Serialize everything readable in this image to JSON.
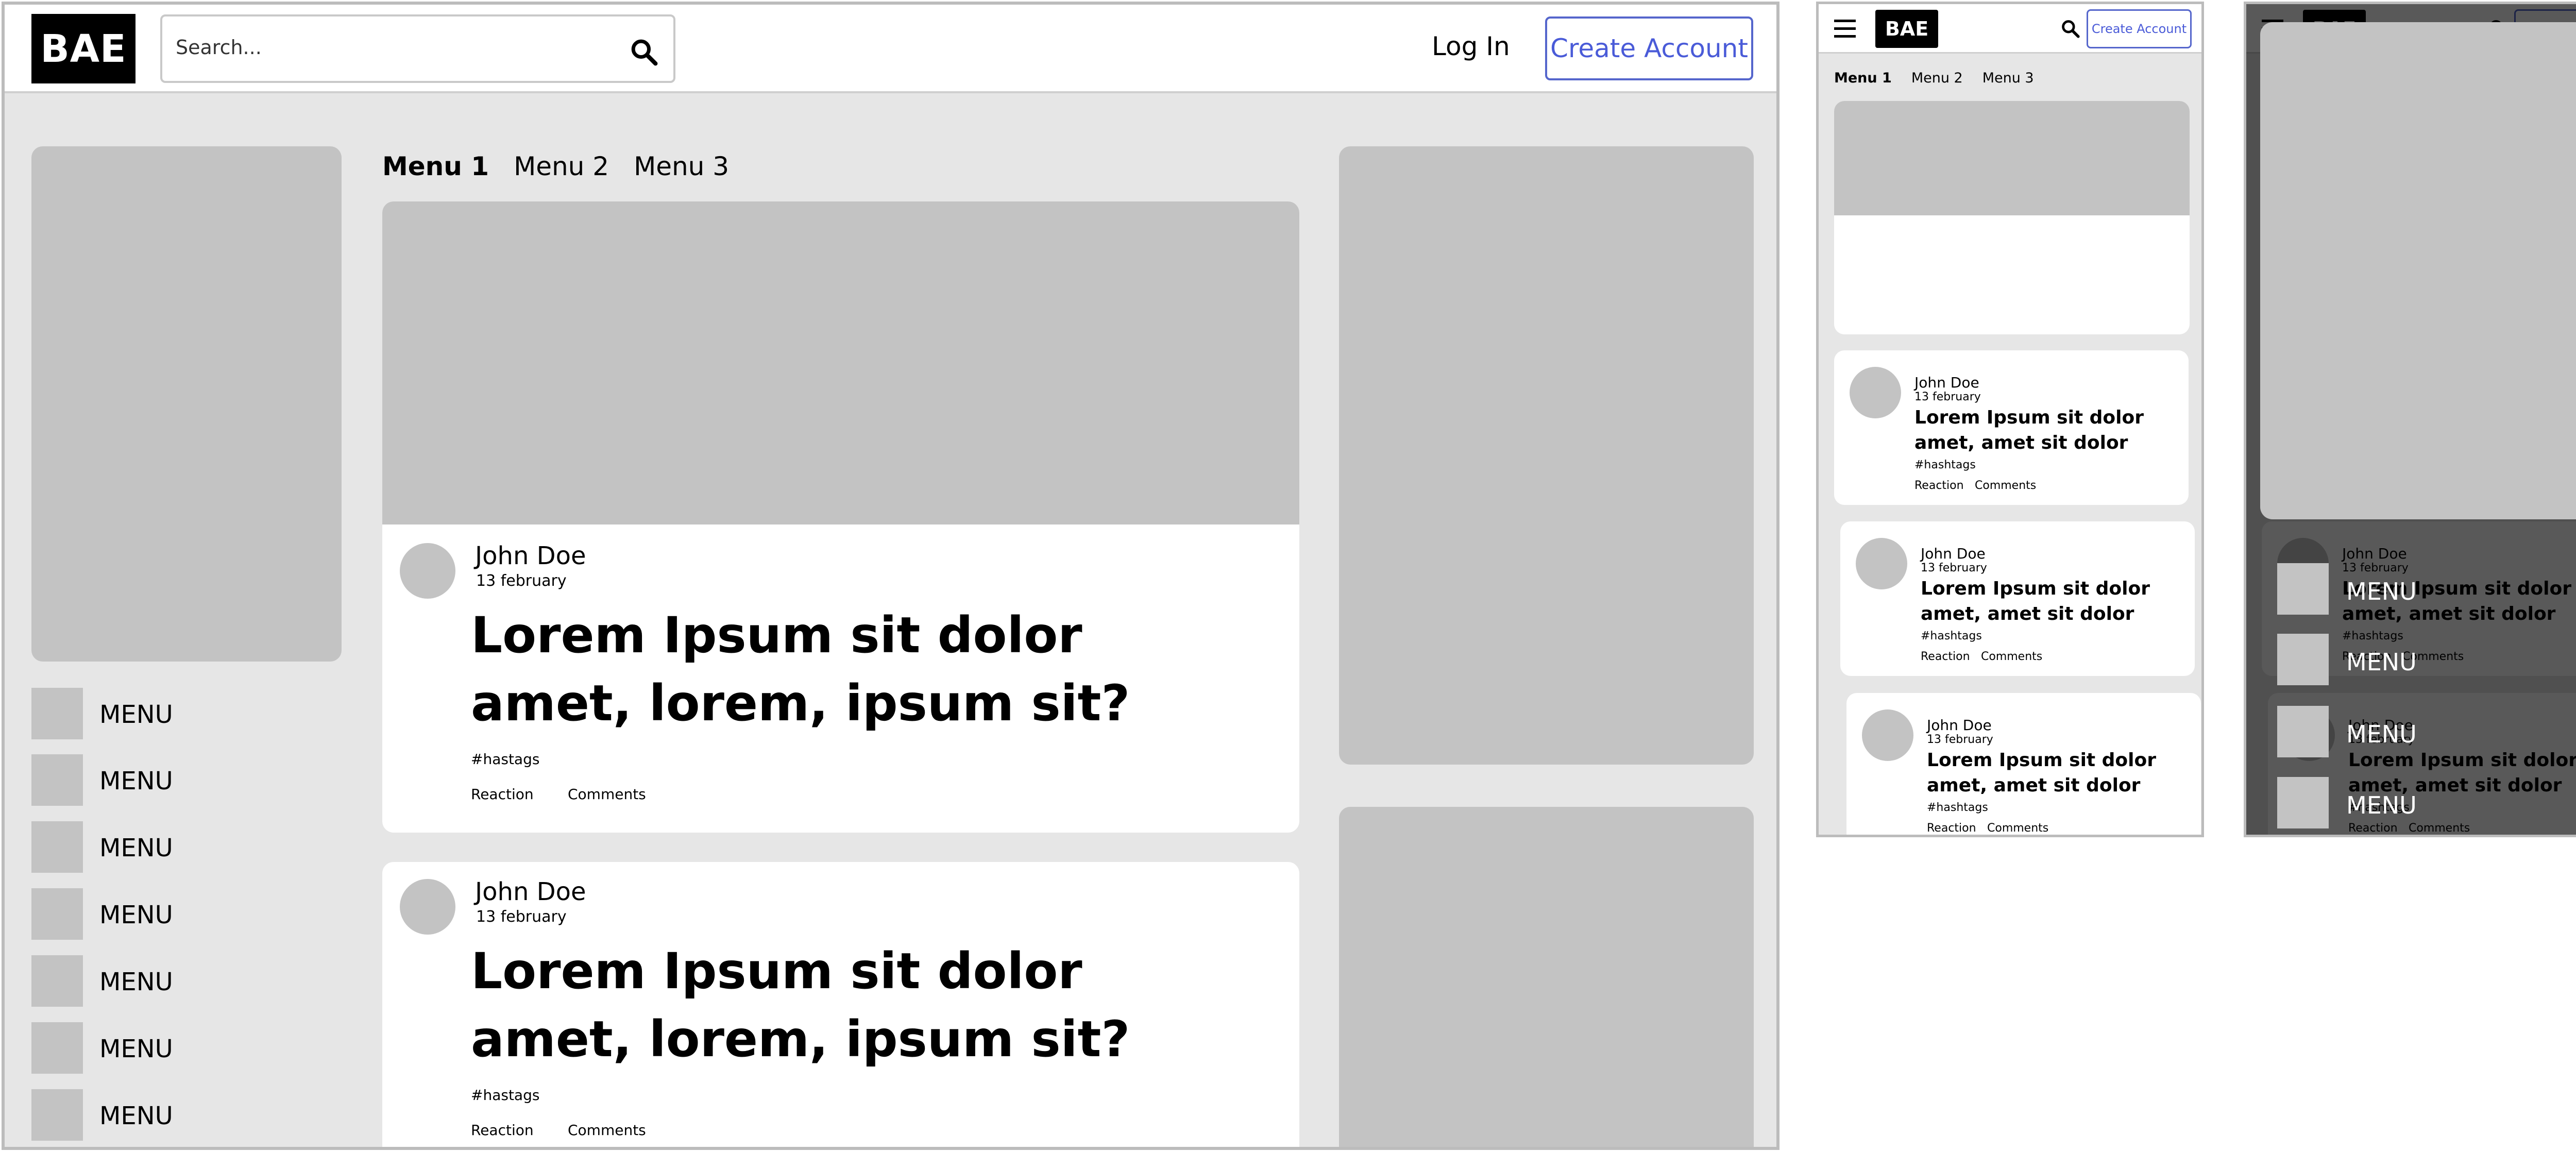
{
  "brand": {
    "logo_text": "BAE",
    "accent": "#4a5bd8"
  },
  "header": {
    "search_placeholder": "Search...",
    "login_label": "Log In",
    "create_account_label": "Create Account"
  },
  "tabs": [
    {
      "label": "Menu 1",
      "active": true
    },
    {
      "label": "Menu 2",
      "active": false
    },
    {
      "label": "Menu 3",
      "active": false
    }
  ],
  "sidebar": {
    "items": [
      {
        "label": "MENU"
      },
      {
        "label": "MENU"
      },
      {
        "label": "MENU"
      },
      {
        "label": "MENU"
      },
      {
        "label": "MENU"
      },
      {
        "label": "MENU"
      },
      {
        "label": "MENU"
      }
    ]
  },
  "desktop_posts": [
    {
      "author": "John Doe",
      "date": "13 february",
      "title": "Lorem Ipsum sit dolor amet, lorem, ipsum sit?",
      "tags": "#hastags",
      "reaction": "Reaction",
      "comments": "Comments"
    },
    {
      "author": "John Doe",
      "date": "13 february",
      "title": "Lorem Ipsum sit dolor amet, lorem, ipsum sit?",
      "tags": "#hastags",
      "reaction": "Reaction",
      "comments": "Comments"
    }
  ],
  "mobile": {
    "create_account_label": "Create Account",
    "posts": [
      {
        "author": "John Doe",
        "date": "13 february",
        "title": "Lorem Ipsum sit dolor amet, amet sit dolor",
        "tags": "#hashtags",
        "reaction": "Reaction",
        "comments": "Comments"
      },
      {
        "author": "John Doe",
        "date": "13 february",
        "title": "Lorem Ipsum sit dolor amet, amet sit dolor",
        "tags": "#hashtags",
        "reaction": "Reaction",
        "comments": "Comments"
      },
      {
        "author": "John Doe",
        "date": "13 february",
        "title": "Lorem Ipsum sit dolor amet, amet sit dolor",
        "tags": "#hashtags",
        "reaction": "Reaction",
        "comments": "Comments"
      }
    ]
  },
  "overlay": {
    "menu_items": [
      {
        "label": "MENU"
      },
      {
        "label": "MENU"
      },
      {
        "label": "MENU"
      },
      {
        "label": "MENU"
      }
    ]
  }
}
